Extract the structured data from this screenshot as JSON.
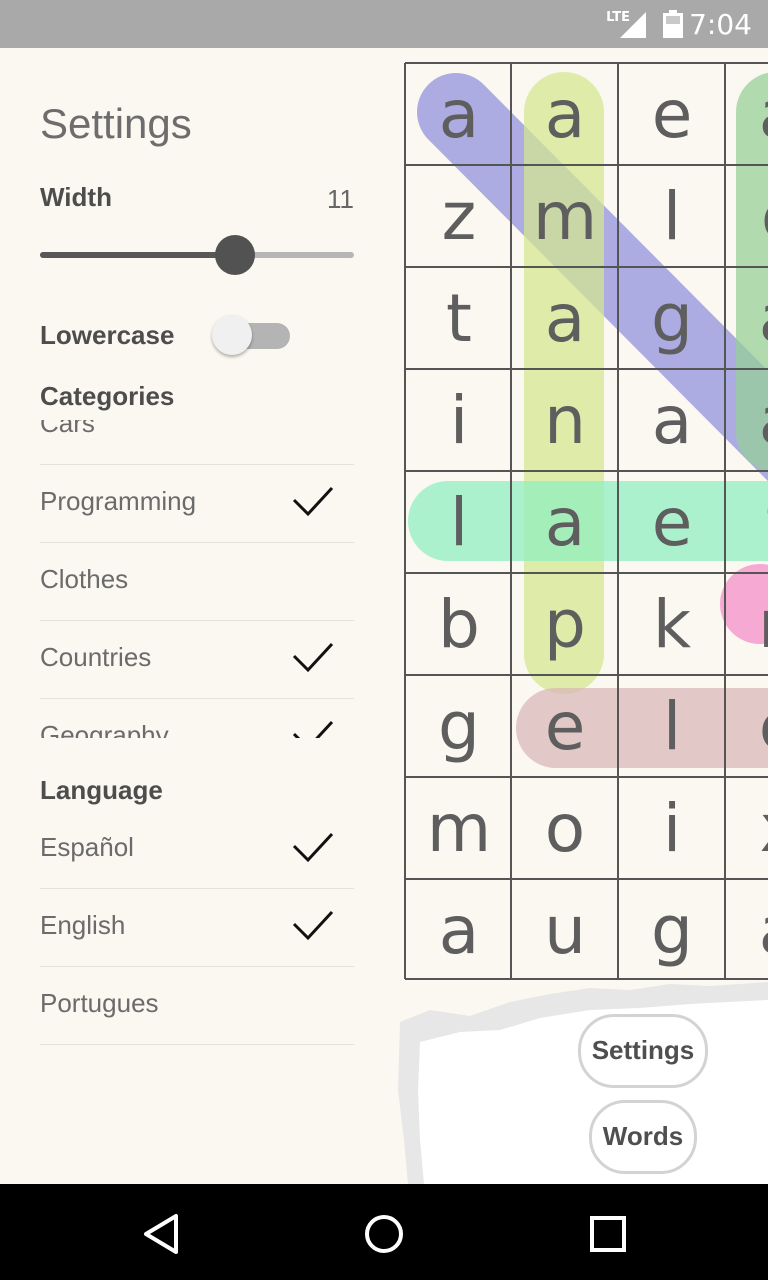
{
  "status_bar": {
    "network": "LTE",
    "time": "7:04"
  },
  "settings": {
    "title": "Settings",
    "width_label": "Width",
    "width_value": "11",
    "width_slider_fraction": 0.62,
    "lowercase_label": "Lowercase",
    "lowercase_on": false,
    "categories_label": "Categories",
    "categories": [
      {
        "label": "Cars",
        "checked": false
      },
      {
        "label": "Programming",
        "checked": true
      },
      {
        "label": "Clothes",
        "checked": false
      },
      {
        "label": "Countries",
        "checked": true
      },
      {
        "label": "Geography",
        "checked": true
      }
    ],
    "language_label": "Language",
    "languages": [
      {
        "label": "Español",
        "checked": true
      },
      {
        "label": "English",
        "checked": true
      },
      {
        "label": "Portugues",
        "checked": false
      }
    ]
  },
  "grid": {
    "rows": [
      [
        "a",
        "a",
        "e",
        "a"
      ],
      [
        "z",
        "m",
        "l",
        "c"
      ],
      [
        "t",
        "a",
        "g",
        "a"
      ],
      [
        "i",
        "n",
        "a",
        "a"
      ],
      [
        "l",
        "a",
        "e",
        "t"
      ],
      [
        "b",
        "p",
        "k",
        "n"
      ],
      [
        "g",
        "e",
        "l",
        "e"
      ],
      [
        "m",
        "o",
        "i",
        "x"
      ],
      [
        "a",
        "u",
        "g",
        "a"
      ]
    ],
    "highlight_colors": [
      "#8f8fdc",
      "#d4e68d",
      "#94d095",
      "#8eeec0",
      "#f48cc8",
      "#d8b5b5"
    ]
  },
  "buttons": {
    "settings": "Settings",
    "words": "Words"
  },
  "nav": {
    "back": "back-icon",
    "home": "home-icon",
    "recents": "recents-icon"
  }
}
